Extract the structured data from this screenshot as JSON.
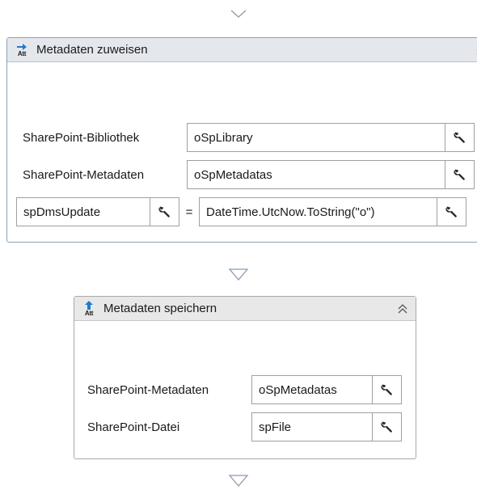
{
  "activities": [
    {
      "title": "Metadaten zuweisen",
      "icon": "assign-arrow-att-icon",
      "fields": [
        {
          "label": "SharePoint-Bibliothek",
          "value": "oSpLibrary"
        },
        {
          "label": "SharePoint-Metadaten",
          "value": "oSpMetadatas"
        }
      ],
      "assignment": {
        "target": "spDmsUpdate",
        "operator": "=",
        "expression": "DateTime.UtcNow.ToString(\"o\")"
      }
    },
    {
      "title": "Metadaten speichern",
      "icon": "save-up-arrow-att-icon",
      "fields": [
        {
          "label": "SharePoint-Metadaten",
          "value": "oSpMetadatas"
        },
        {
          "label": "SharePoint-Datei",
          "value": "spFile"
        }
      ]
    }
  ],
  "icon_text": "Att",
  "colors": {
    "accent_blue": "#1e7bd0",
    "border_blue": "#8aa0b8",
    "header_bg": "#e4e7ec"
  }
}
